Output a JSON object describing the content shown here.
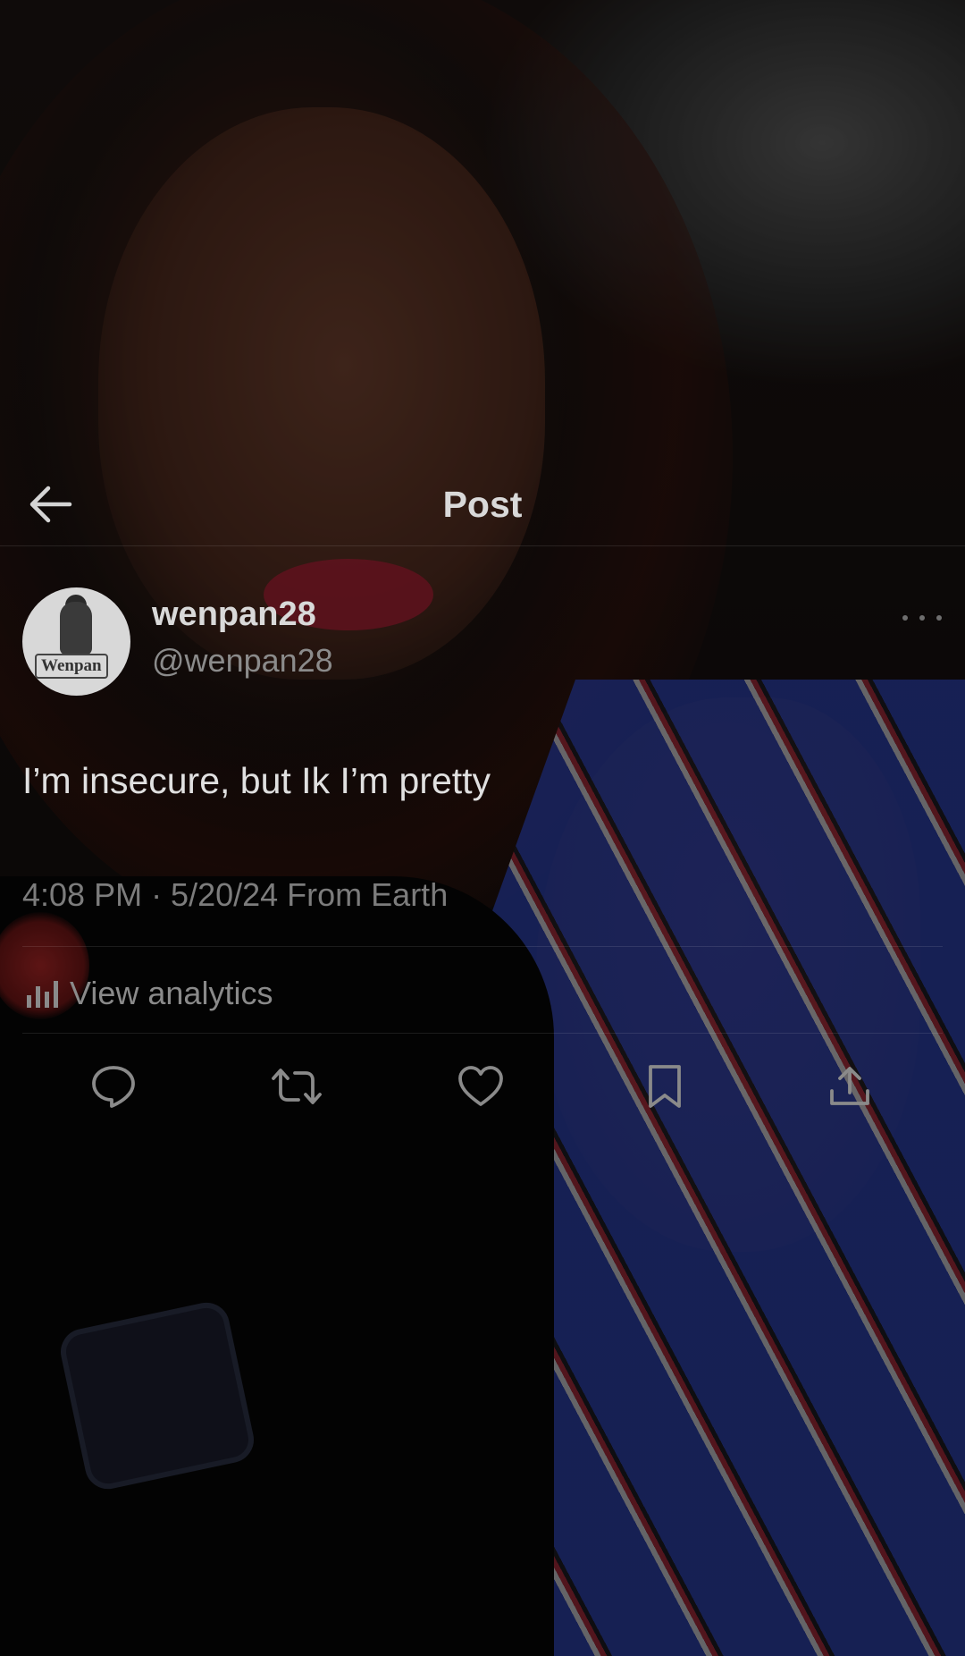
{
  "header": {
    "title": "Post",
    "back_icon": "arrow-left-icon"
  },
  "post": {
    "display_name": "wenpan28",
    "handle": "@wenpan28",
    "avatar_label": "Wenpan",
    "text": "I’m insecure, but Ik I’m pretty",
    "timestamp": "4:08 PM · 5/20/24 From Earth",
    "analytics_label": "View analytics",
    "more_icon": "more-horizontal-icon"
  },
  "actions": [
    {
      "icon": "reply-icon"
    },
    {
      "icon": "repost-icon"
    },
    {
      "icon": "like-icon"
    },
    {
      "icon": "bookmark-icon"
    },
    {
      "icon": "share-icon"
    }
  ],
  "colors": {
    "text_primary": "#e0e0e0",
    "text_secondary": "#8b8b8b",
    "scrim": "#000000"
  }
}
